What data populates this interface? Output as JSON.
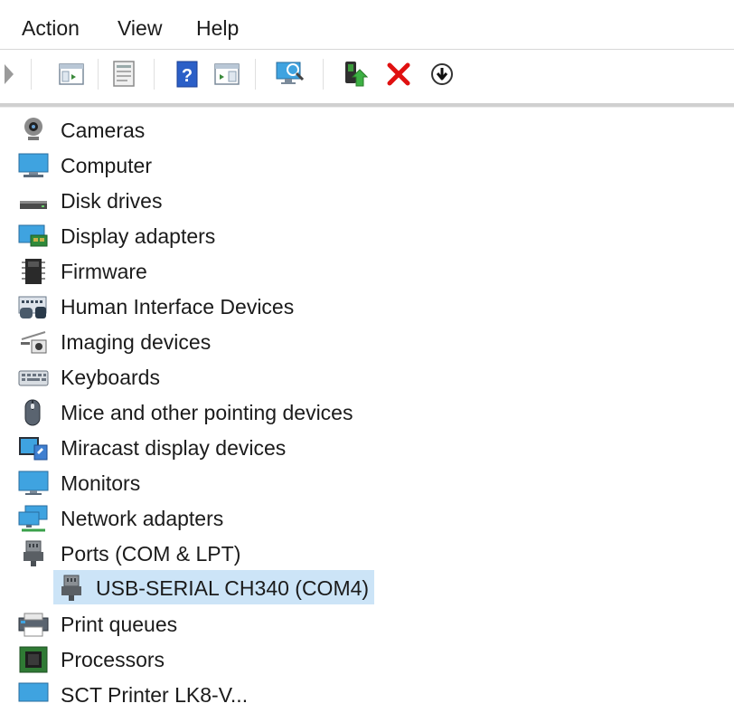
{
  "menu": {
    "action": "Action",
    "view": "View",
    "help": "Help"
  },
  "toolbar": {
    "buttons": [
      "back-arrow-icon",
      "show-hide-tree-icon",
      "properties-icon",
      "help-icon",
      "action-pane-icon",
      "scan-hardware-icon",
      "update-driver-icon",
      "uninstall-device-icon",
      "disable-device-icon"
    ]
  },
  "tree": {
    "items": [
      {
        "label": "Cameras",
        "icon": "camera-icon"
      },
      {
        "label": "Computer",
        "icon": "computer-icon"
      },
      {
        "label": "Disk drives",
        "icon": "disk-drive-icon"
      },
      {
        "label": "Display adapters",
        "icon": "display-adapter-icon"
      },
      {
        "label": "Firmware",
        "icon": "firmware-icon"
      },
      {
        "label": "Human Interface Devices",
        "icon": "hid-icon"
      },
      {
        "label": "Imaging devices",
        "icon": "imaging-device-icon"
      },
      {
        "label": "Keyboards",
        "icon": "keyboard-icon"
      },
      {
        "label": "Mice and other pointing devices",
        "icon": "mouse-icon"
      },
      {
        "label": "Miracast display devices",
        "icon": "miracast-icon"
      },
      {
        "label": "Monitors",
        "icon": "monitor-icon"
      },
      {
        "label": "Network adapters",
        "icon": "network-adapter-icon"
      },
      {
        "label": "Ports (COM & LPT)",
        "icon": "port-icon"
      },
      {
        "label": "USB-SERIAL CH340 (COM4)",
        "icon": "port-icon"
      },
      {
        "label": "Print queues",
        "icon": "printer-icon"
      },
      {
        "label": "Processors",
        "icon": "processor-icon"
      },
      {
        "label": "SCT Printer LK8-V...",
        "icon": "software-device-icon"
      }
    ]
  },
  "colors": {
    "selection": "#cce4f7",
    "help_blue": "#2b5fc7",
    "delete_red": "#e01010"
  }
}
